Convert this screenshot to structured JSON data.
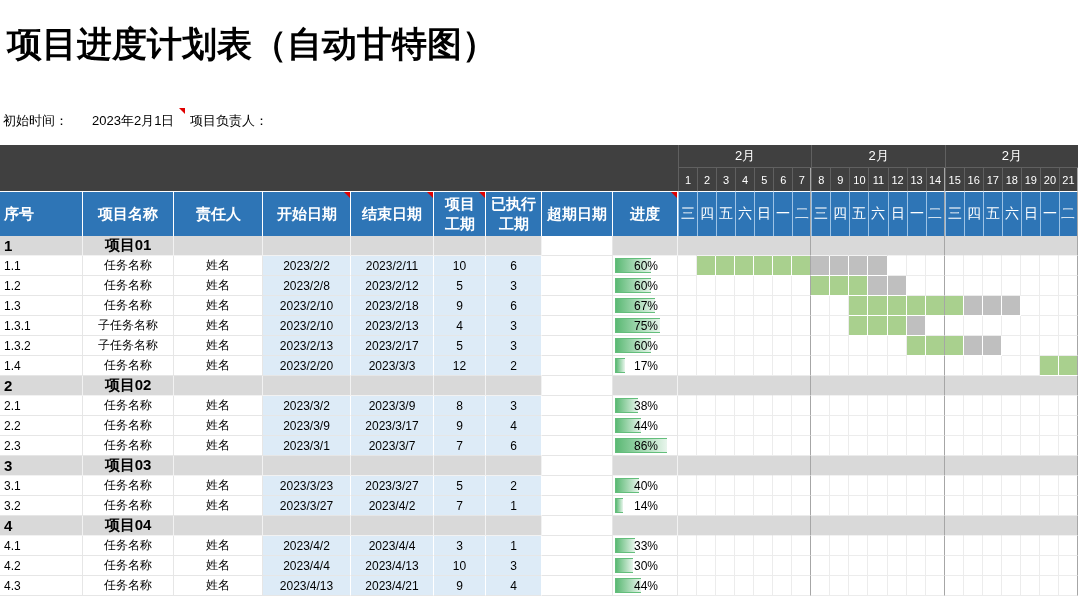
{
  "title": "项目进度计划表（自动甘特图）",
  "info": {
    "start_label": "初始时间：",
    "start_value": "2023年2月1日",
    "start_comment": true,
    "owner_label": "项目负责人："
  },
  "timeline": {
    "months": [
      "2月",
      "2月",
      "2月"
    ],
    "days": [
      "1",
      "2",
      "3",
      "4",
      "5",
      "6",
      "7",
      "8",
      "9",
      "10",
      "11",
      "12",
      "13",
      "14",
      "15",
      "16",
      "17",
      "18",
      "19",
      "20",
      "21"
    ],
    "weekdays": [
      "三",
      "四",
      "五",
      "六",
      "日",
      "一",
      "二",
      "三",
      "四",
      "五",
      "六",
      "日",
      "一",
      "二",
      "三",
      "四",
      "五",
      "六",
      "日",
      "一",
      "二"
    ]
  },
  "columns": [
    {
      "label": "序号",
      "comment": false
    },
    {
      "label": "项目名称",
      "comment": false
    },
    {
      "label": "责任人",
      "comment": false
    },
    {
      "label": "开始日期",
      "comment": true
    },
    {
      "label": "结束日期",
      "comment": true
    },
    {
      "label": "项目工期",
      "comment": true
    },
    {
      "label": "已执行工期",
      "comment": false
    },
    {
      "label": "超期日期",
      "comment": false
    },
    {
      "label": "进度",
      "comment": true
    }
  ],
  "rows": [
    {
      "kind": "group",
      "no": "1",
      "name": "项目01"
    },
    {
      "kind": "task",
      "no": "1.1",
      "name": "任务名称",
      "owner": "姓名",
      "start": "2023/2/2",
      "end": "2023/2/11",
      "duration": "10",
      "done": "6",
      "progress": "60%",
      "level": 0.6,
      "days": [
        {
          "kind": "empty"
        },
        {
          "kind": "completed"
        },
        {
          "kind": "completed"
        },
        {
          "kind": "completed"
        },
        {
          "kind": "completed"
        },
        {
          "kind": "completed"
        },
        {
          "kind": "completed"
        },
        {
          "kind": "remaining"
        },
        {
          "kind": "remaining"
        },
        {
          "kind": "remaining"
        },
        {
          "kind": "remaining"
        },
        {
          "kind": "empty"
        },
        {
          "kind": "empty"
        },
        {
          "kind": "empty"
        },
        {
          "kind": "empty"
        },
        {
          "kind": "empty"
        },
        {
          "kind": "empty"
        },
        {
          "kind": "empty"
        },
        {
          "kind": "empty"
        },
        {
          "kind": "empty"
        },
        {
          "kind": "empty"
        }
      ]
    },
    {
      "kind": "task",
      "no": "1.2",
      "name": "任务名称",
      "owner": "姓名",
      "start": "2023/2/8",
      "end": "2023/2/12",
      "duration": "5",
      "done": "3",
      "progress": "60%",
      "level": 0.6,
      "days": [
        {
          "kind": "empty"
        },
        {
          "kind": "empty"
        },
        {
          "kind": "empty"
        },
        {
          "kind": "empty"
        },
        {
          "kind": "empty"
        },
        {
          "kind": "empty"
        },
        {
          "kind": "empty"
        },
        {
          "kind": "completed"
        },
        {
          "kind": "completed"
        },
        {
          "kind": "completed"
        },
        {
          "kind": "remaining"
        },
        {
          "kind": "remaining"
        },
        {
          "kind": "empty"
        },
        {
          "kind": "empty"
        },
        {
          "kind": "empty"
        },
        {
          "kind": "empty"
        },
        {
          "kind": "empty"
        },
        {
          "kind": "empty"
        },
        {
          "kind": "empty"
        },
        {
          "kind": "empty"
        },
        {
          "kind": "empty"
        }
      ]
    },
    {
      "kind": "task",
      "no": "1.3",
      "name": "任务名称",
      "owner": "姓名",
      "start": "2023/2/10",
      "end": "2023/2/18",
      "duration": "9",
      "done": "6",
      "progress": "67%",
      "level": 0.67,
      "days": [
        {
          "kind": "empty"
        },
        {
          "kind": "empty"
        },
        {
          "kind": "empty"
        },
        {
          "kind": "empty"
        },
        {
          "kind": "empty"
        },
        {
          "kind": "empty"
        },
        {
          "kind": "empty"
        },
        {
          "kind": "empty"
        },
        {
          "kind": "empty"
        },
        {
          "kind": "completed"
        },
        {
          "kind": "completed"
        },
        {
          "kind": "completed"
        },
        {
          "kind": "completed"
        },
        {
          "kind": "completed"
        },
        {
          "kind": "completed"
        },
        {
          "kind": "remaining"
        },
        {
          "kind": "remaining"
        },
        {
          "kind": "remaining"
        },
        {
          "kind": "empty"
        },
        {
          "kind": "empty"
        },
        {
          "kind": "empty"
        }
      ]
    },
    {
      "kind": "task",
      "no": "1.3.1",
      "name": "子任务名称",
      "owner": "姓名",
      "start": "2023/2/10",
      "end": "2023/2/13",
      "duration": "4",
      "done": "3",
      "progress": "75%",
      "level": 0.75,
      "days": [
        {
          "kind": "empty"
        },
        {
          "kind": "empty"
        },
        {
          "kind": "empty"
        },
        {
          "kind": "empty"
        },
        {
          "kind": "empty"
        },
        {
          "kind": "empty"
        },
        {
          "kind": "empty"
        },
        {
          "kind": "empty"
        },
        {
          "kind": "empty"
        },
        {
          "kind": "completed"
        },
        {
          "kind": "completed"
        },
        {
          "kind": "completed"
        },
        {
          "kind": "remaining"
        },
        {
          "kind": "empty"
        },
        {
          "kind": "empty"
        },
        {
          "kind": "empty"
        },
        {
          "kind": "empty"
        },
        {
          "kind": "empty"
        },
        {
          "kind": "empty"
        },
        {
          "kind": "empty"
        },
        {
          "kind": "empty"
        }
      ]
    },
    {
      "kind": "task",
      "no": "1.3.2",
      "name": "子任务名称",
      "owner": "姓名",
      "start": "2023/2/13",
      "end": "2023/2/17",
      "duration": "5",
      "done": "3",
      "progress": "60%",
      "level": 0.6,
      "days": [
        {
          "kind": "empty"
        },
        {
          "kind": "empty"
        },
        {
          "kind": "empty"
        },
        {
          "kind": "empty"
        },
        {
          "kind": "empty"
        },
        {
          "kind": "empty"
        },
        {
          "kind": "empty"
        },
        {
          "kind": "empty"
        },
        {
          "kind": "empty"
        },
        {
          "kind": "empty"
        },
        {
          "kind": "empty"
        },
        {
          "kind": "empty"
        },
        {
          "kind": "completed"
        },
        {
          "kind": "completed"
        },
        {
          "kind": "completed"
        },
        {
          "kind": "remaining"
        },
        {
          "kind": "remaining"
        },
        {
          "kind": "empty"
        },
        {
          "kind": "empty"
        },
        {
          "kind": "empty"
        },
        {
          "kind": "empty"
        }
      ]
    },
    {
      "kind": "task",
      "no": "1.4",
      "name": "任务名称",
      "owner": "姓名",
      "start": "2023/2/20",
      "end": "2023/3/3",
      "duration": "12",
      "done": "2",
      "progress": "17%",
      "level": 0.17,
      "days": [
        {
          "kind": "empty"
        },
        {
          "kind": "empty"
        },
        {
          "kind": "empty"
        },
        {
          "kind": "empty"
        },
        {
          "kind": "empty"
        },
        {
          "kind": "empty"
        },
        {
          "kind": "empty"
        },
        {
          "kind": "empty"
        },
        {
          "kind": "empty"
        },
        {
          "kind": "empty"
        },
        {
          "kind": "empty"
        },
        {
          "kind": "empty"
        },
        {
          "kind": "empty"
        },
        {
          "kind": "empty"
        },
        {
          "kind": "empty"
        },
        {
          "kind": "empty"
        },
        {
          "kind": "empty"
        },
        {
          "kind": "empty"
        },
        {
          "kind": "empty"
        },
        {
          "kind": "completed"
        },
        {
          "kind": "completed"
        }
      ]
    },
    {
      "kind": "group",
      "no": "2",
      "name": "项目02"
    },
    {
      "kind": "task",
      "no": "2.1",
      "name": "任务名称",
      "owner": "姓名",
      "start": "2023/3/2",
      "end": "2023/3/9",
      "duration": "8",
      "done": "3",
      "progress": "38%",
      "level": 0.38
    },
    {
      "kind": "task",
      "no": "2.2",
      "name": "任务名称",
      "owner": "姓名",
      "start": "2023/3/9",
      "end": "2023/3/17",
      "duration": "9",
      "done": "4",
      "progress": "44%",
      "level": 0.44
    },
    {
      "kind": "task",
      "no": "2.3",
      "name": "任务名称",
      "owner": "姓名",
      "start": "2023/3/1",
      "end": "2023/3/7",
      "duration": "7",
      "done": "6",
      "progress": "86%",
      "level": 0.86
    },
    {
      "kind": "group",
      "no": "3",
      "name": "项目03"
    },
    {
      "kind": "task",
      "no": "3.1",
      "name": "任务名称",
      "owner": "姓名",
      "start": "2023/3/23",
      "end": "2023/3/27",
      "duration": "5",
      "done": "2",
      "progress": "40%",
      "level": 0.4
    },
    {
      "kind": "task",
      "no": "3.2",
      "name": "任务名称",
      "owner": "姓名",
      "start": "2023/3/27",
      "end": "2023/4/2",
      "duration": "7",
      "done": "1",
      "progress": "14%",
      "level": 0.14
    },
    {
      "kind": "group",
      "no": "4",
      "name": "项目04"
    },
    {
      "kind": "task",
      "no": "4.1",
      "name": "任务名称",
      "owner": "姓名",
      "start": "2023/4/2",
      "end": "2023/4/4",
      "duration": "3",
      "done": "1",
      "progress": "33%",
      "level": 0.33
    },
    {
      "kind": "task",
      "no": "4.2",
      "name": "任务名称",
      "owner": "姓名",
      "start": "2023/4/4",
      "end": "2023/4/13",
      "duration": "10",
      "done": "3",
      "progress": "30%",
      "level": 0.3
    },
    {
      "kind": "task",
      "no": "4.3",
      "name": "任务名称",
      "owner": "姓名",
      "start": "2023/4/13",
      "end": "2023/4/21",
      "duration": "9",
      "done": "4",
      "progress": "44%",
      "level": 0.44
    }
  ]
}
